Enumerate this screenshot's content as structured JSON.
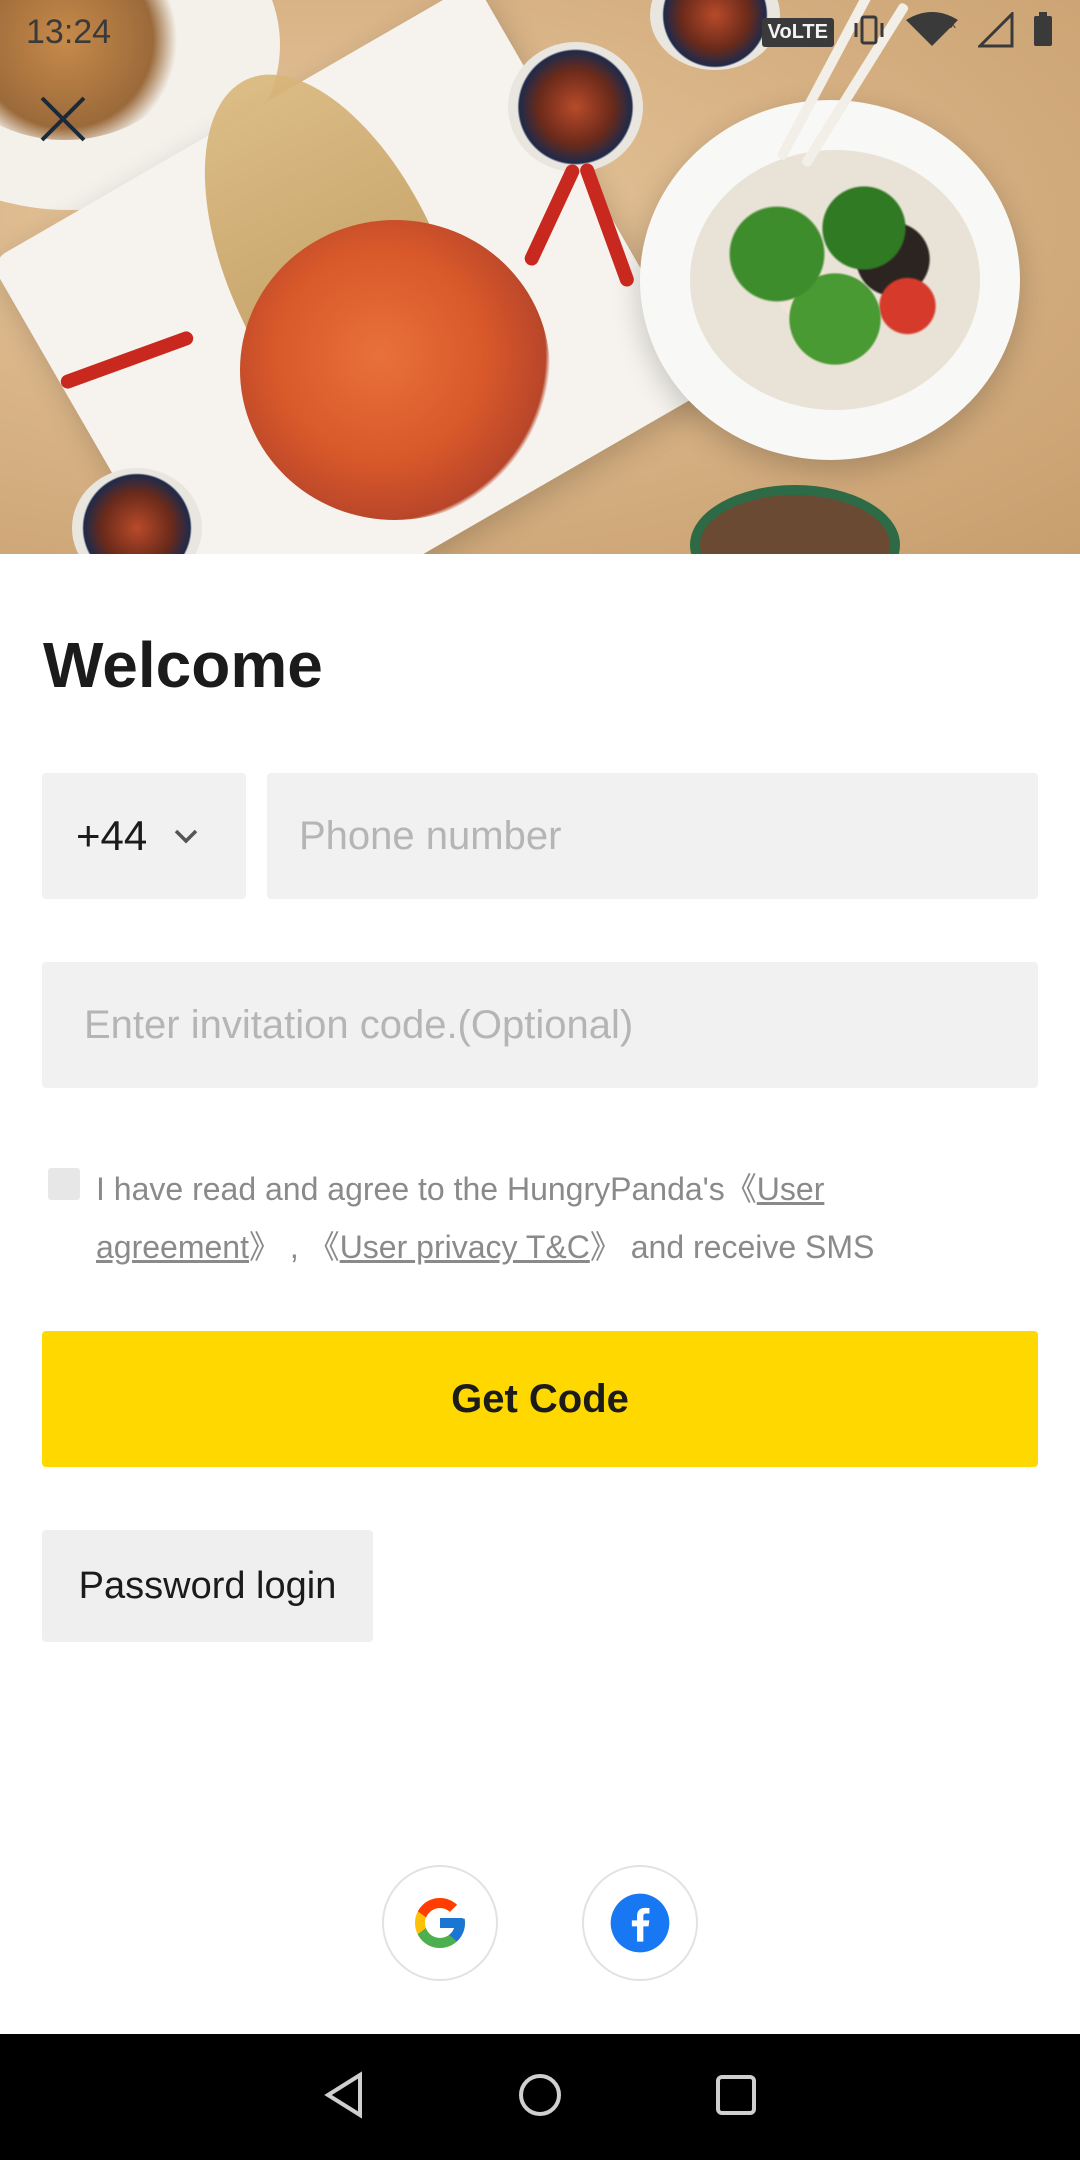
{
  "status_bar": {
    "time": "13:24",
    "volte_label": "VoLTE",
    "icons": [
      "vibrate-icon",
      "wifi-icon",
      "signal-icon",
      "battery-icon"
    ]
  },
  "hero": {
    "image_description_icon": "food-banner-image"
  },
  "header": {
    "close_icon": "close-icon"
  },
  "main": {
    "title": "Welcome",
    "country_code": "+44",
    "phone_placeholder": "Phone number",
    "invite_placeholder": "Enter invitation code.(Optional)",
    "agreement": {
      "prefix": "I have read and agree to the HungryPanda's",
      "open_bracket_1": "《",
      "link1": "User agreement",
      "close_bracket_1": "》",
      "separator": " , ",
      "open_bracket_2": "《",
      "link2": "User privacy T&C",
      "close_bracket_2": "》",
      "suffix": " and receive SMS"
    },
    "get_code_label": "Get Code",
    "password_login_label": "Password login"
  },
  "social": {
    "google_icon": "google-icon",
    "facebook_icon": "facebook-icon"
  },
  "colors": {
    "accent": "#ffd800",
    "field_bg": "#f1f1f1",
    "placeholder": "#b5b5b5",
    "text": "#1b1b1b",
    "facebook": "#1877f2"
  }
}
